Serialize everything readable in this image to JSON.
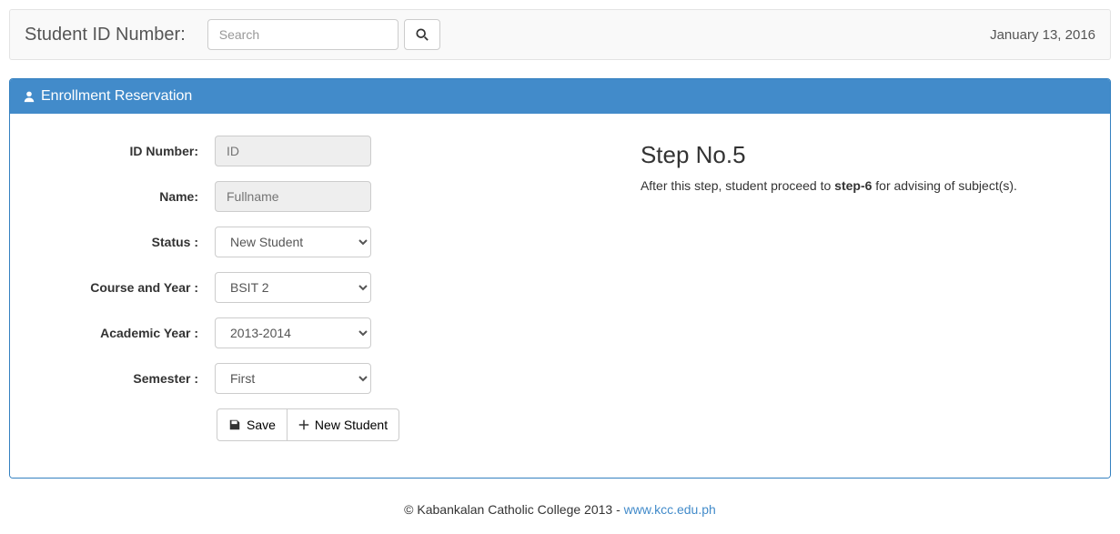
{
  "topbar": {
    "search_label": "Student ID Number:",
    "search_placeholder": "Search",
    "date": "January 13, 2016"
  },
  "panel": {
    "title": "Enrollment Reservation"
  },
  "form": {
    "labels": {
      "id": "ID Number:",
      "name": "Name:",
      "status": "Status :",
      "course_year": "Course and Year :",
      "acad_year": "Academic Year :",
      "semester": "Semester :"
    },
    "id_placeholder": "ID",
    "name_placeholder": "Fullname",
    "status_value": "New Student",
    "course_year_value": "BSIT 2",
    "acad_year_value": "2013-2014",
    "semester_value": "First",
    "save_label": "Save",
    "new_student_label": "New Student"
  },
  "info": {
    "heading": "Step No.5",
    "text_prefix": "After this step, student proceed to ",
    "text_bold": "step-6",
    "text_suffix": " for advising of subject(s)."
  },
  "footer": {
    "text": "© Kabankalan Catholic College 2013 - ",
    "link_text": "www.kcc.edu.ph"
  }
}
